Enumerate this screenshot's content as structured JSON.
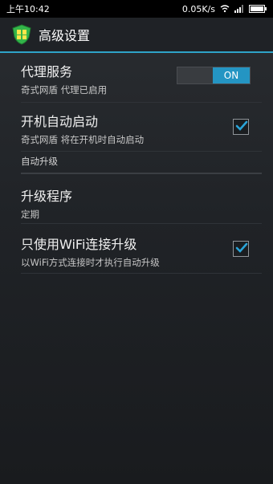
{
  "status_bar": {
    "time": "上午10:42",
    "speed": "0.05K/s",
    "icons": [
      "wifi-icon",
      "signal-icon",
      "battery-icon"
    ]
  },
  "title_bar": {
    "title": "高级设置",
    "icon": "shield-app-icon"
  },
  "settings": {
    "proxy": {
      "title": "代理服务",
      "subtitle": "奇式网盾 代理已启用",
      "toggle_label": "ON",
      "enabled": true
    },
    "autostart": {
      "title": "开机自动启动",
      "subtitle": "奇式网盾 将在开机时自动启动",
      "checked": true
    },
    "section_auto_upgrade": "自动升级",
    "upgrade_program": {
      "title": "升级程序",
      "subtitle": "定期"
    },
    "wifi_only": {
      "title": "只使用WiFi连接升级",
      "subtitle": "以WiFi方式连接时才执行自动升级",
      "checked": true
    }
  },
  "colors": {
    "accent": "#2495c3",
    "divider": "#2fa3c8",
    "background": "#202327"
  }
}
